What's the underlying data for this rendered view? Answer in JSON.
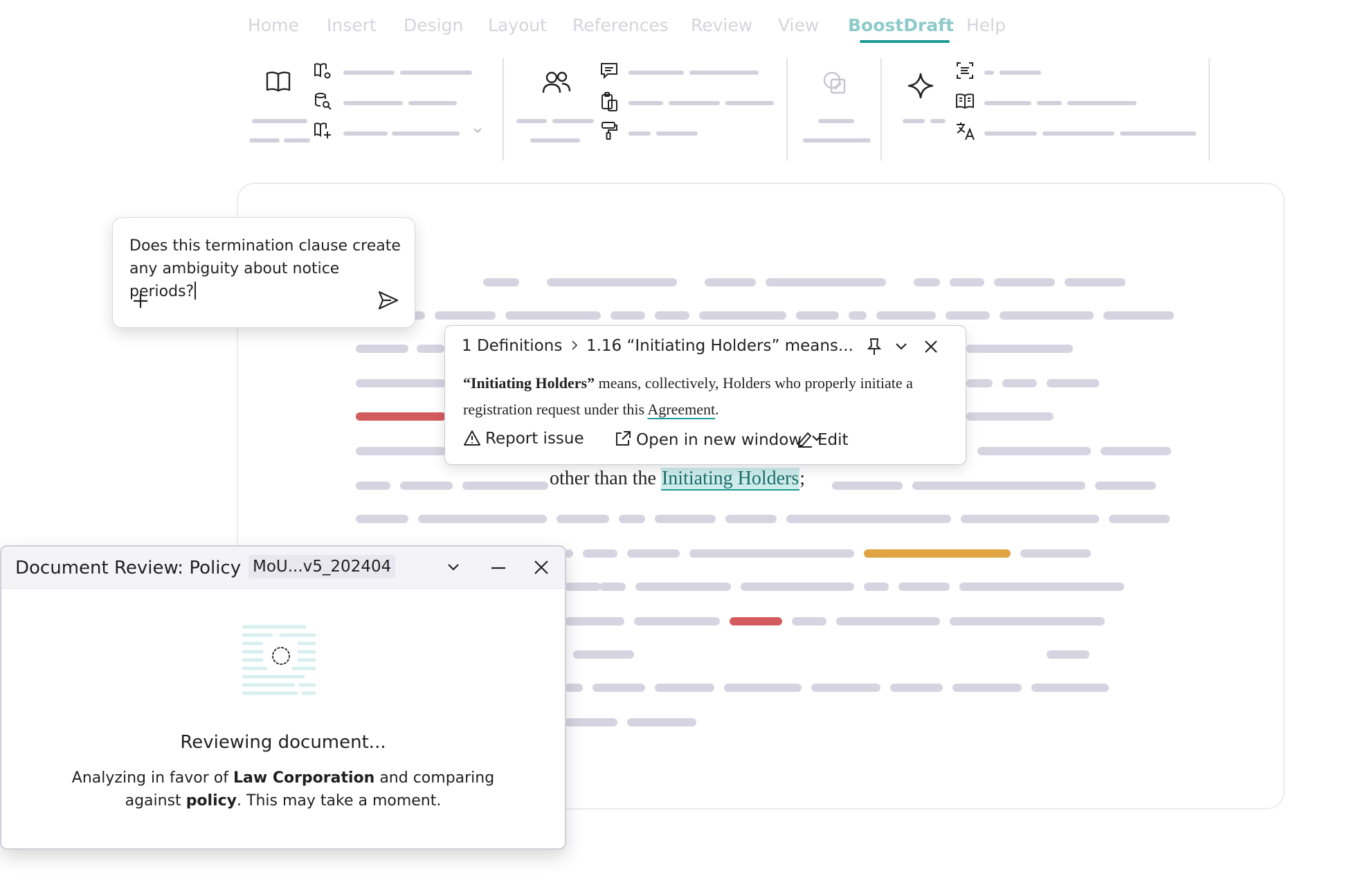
{
  "ribbon": {
    "tabs": [
      {
        "label": "Home"
      },
      {
        "label": "Insert"
      },
      {
        "label": "Design"
      },
      {
        "label": "Layout"
      },
      {
        "label": "References"
      },
      {
        "label": "Review"
      },
      {
        "label": "View"
      },
      {
        "label": "BoostDraft",
        "active": true
      },
      {
        "label": "Help"
      }
    ],
    "accent_color": "#1d9a93"
  },
  "chat": {
    "question": "Does this termination clause create any ambiguity about notice periods?"
  },
  "definition_popup": {
    "breadcrumb_section": "1 Definitions",
    "breadcrumb_item": "1.16 “Initiating Holders” means...",
    "term": "“Initiating Holders”",
    "body_1": " means, collectively, Holders who properly initiate a registration request under ",
    "body_2": "this ",
    "body_link": "Agreement",
    "body_end": ".",
    "report_label": "Report issue",
    "open_label": "Open in new window",
    "edit_label": "Edit"
  },
  "document": {
    "text_before": "other than the ",
    "highlight": "Initiating Holders",
    "text_after": ";"
  },
  "review_panel": {
    "title": "Document Review: Policy",
    "file": "MoU...v5_202404",
    "status": "Reviewing document...",
    "desc_1": "Analyzing in favor of ",
    "party": "Law Corporation",
    "desc_2": " and comparing",
    "desc_3": "against ",
    "policy": "policy",
    "desc_4": ". This may take a moment."
  }
}
